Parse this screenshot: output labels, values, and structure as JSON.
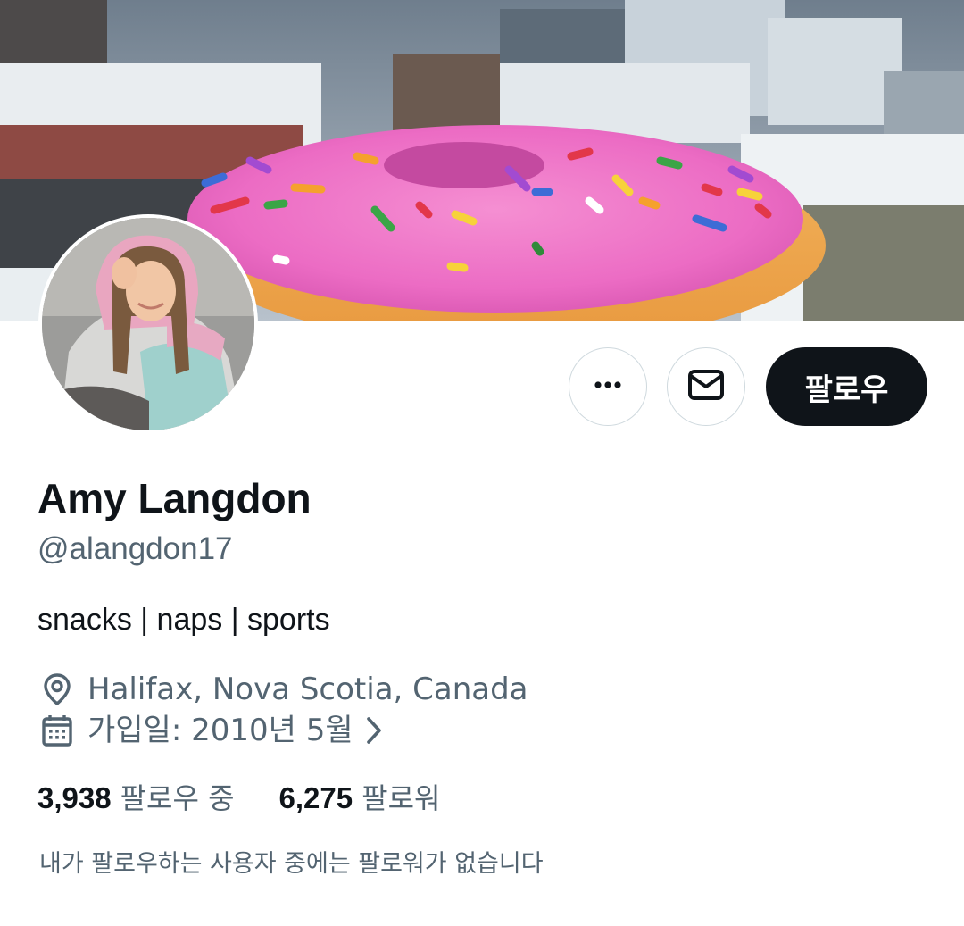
{
  "profile": {
    "name": "Amy Langdon",
    "handle": "@alangdon17",
    "bio": "snacks | naps | sports",
    "location": "Halifax, Nova Scotia, Canada",
    "joined": "가입일: 2010년 5월"
  },
  "actions": {
    "more_icon": "more-horizontal-icon",
    "mail_icon": "envelope-icon",
    "follow_label": "팔로우"
  },
  "stats": {
    "following_count": "3,938",
    "following_label": "팔로우 중",
    "followers_count": "6,275",
    "followers_label": "팔로워"
  },
  "note": "내가 팔로우하는 사용자 중에는 팔로워가 없습니다",
  "colors": {
    "primary_text": "#0f1419",
    "secondary_text": "#536471",
    "button_dark": "#0f1419",
    "border": "#cfd9de"
  }
}
